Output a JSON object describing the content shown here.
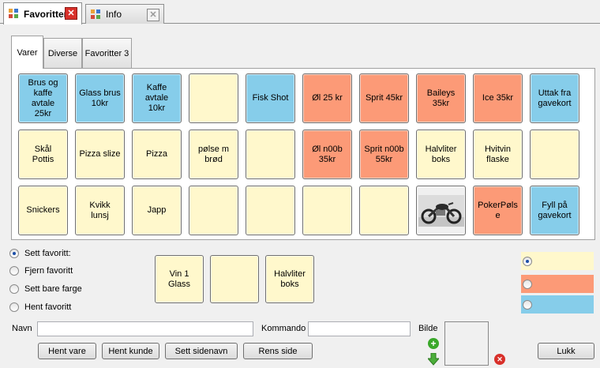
{
  "doc_tabs": [
    {
      "label": "Favoritter"
    },
    {
      "label": "Info"
    }
  ],
  "inner_tabs": [
    {
      "label": "Varer"
    },
    {
      "label": "Diverse"
    },
    {
      "label": "Favoritter 3"
    }
  ],
  "favorites": [
    {
      "label": "Brus og\nkaffe\navtale\n25kr",
      "color": "blue"
    },
    {
      "label": "Glass brus\n10kr",
      "color": "blue"
    },
    {
      "label": "Kaffe\navtale\n10kr",
      "color": "blue"
    },
    {
      "label": "",
      "color": "yellow"
    },
    {
      "label": "Fisk Shot",
      "color": "blue"
    },
    {
      "label": "Øl 25 kr",
      "color": "orange"
    },
    {
      "label": "Sprit 45kr",
      "color": "orange"
    },
    {
      "label": "Baileys\n35kr",
      "color": "orange"
    },
    {
      "label": "Ice 35kr",
      "color": "orange"
    },
    {
      "label": "Uttak fra\ngavekort",
      "color": "blue"
    },
    {
      "label": "Skål\nPottis",
      "color": "yellow"
    },
    {
      "label": "Pizza slize",
      "color": "yellow"
    },
    {
      "label": "Pizza",
      "color": "yellow"
    },
    {
      "label": "pølse m\nbrød",
      "color": "yellow"
    },
    {
      "label": "",
      "color": "yellow"
    },
    {
      "label": "Øl n00b\n35kr",
      "color": "orange"
    },
    {
      "label": "Sprit n00b\n55kr",
      "color": "orange"
    },
    {
      "label": "Halvliter\nboks",
      "color": "yellow"
    },
    {
      "label": "Hvitvin\nflaske",
      "color": "yellow"
    },
    {
      "label": "",
      "color": "yellow"
    },
    {
      "label": "Snickers",
      "color": "yellow"
    },
    {
      "label": "Kvikk\nlunsj",
      "color": "yellow"
    },
    {
      "label": "Japp",
      "color": "yellow"
    },
    {
      "label": "",
      "color": "yellow"
    },
    {
      "label": "",
      "color": "yellow"
    },
    {
      "label": "",
      "color": "yellow"
    },
    {
      "label": "",
      "color": "yellow"
    },
    {
      "label": "",
      "color": "image",
      "icon": "motorcycle-photo"
    },
    {
      "label": "PokerPøls\ne",
      "color": "orange"
    },
    {
      "label": "Fyll på\ngavekort",
      "color": "blue"
    }
  ],
  "modes": [
    {
      "label": "Sett favoritt:",
      "checked": true
    },
    {
      "label": "Fjern favoritt",
      "checked": false
    },
    {
      "label": "Sett bare farge",
      "checked": false
    },
    {
      "label": "Hent favoritt",
      "checked": false
    }
  ],
  "temp_favorites": [
    {
      "label": "Vin 1\nGlass"
    },
    {
      "label": ""
    },
    {
      "label": "Halvliter\nboks"
    }
  ],
  "color_options": [
    {
      "color": "#fff8cc",
      "checked": true
    },
    {
      "color": "#fc9a77",
      "checked": false
    },
    {
      "color": "#86cdea",
      "checked": false
    }
  ],
  "colors": {
    "yellow": "#fff8cc",
    "orange": "#fc9a77",
    "blue": "#86cdea"
  },
  "form": {
    "navn_label": "Navn",
    "navn_value": "",
    "kommando_label": "Kommando",
    "kommando_value": "",
    "bilde_label": "Bilde"
  },
  "buttons": {
    "hent_vare": "Hent vare",
    "hent_kunde": "Hent kunde",
    "sett_sidenavn": "Sett sidenavn",
    "rens_side": "Rens side",
    "lukk": "Lukk"
  },
  "icons": {
    "add": "add-icon",
    "down": "arrow-down-icon",
    "remove": "remove-icon"
  }
}
